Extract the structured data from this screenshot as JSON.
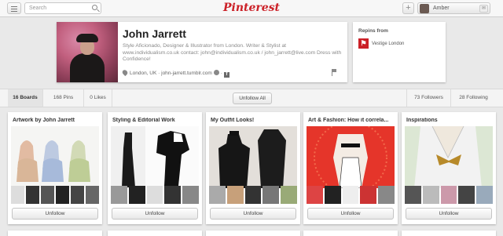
{
  "header": {
    "search_placeholder": "Search",
    "logo": "Pinterest",
    "add_label": "+",
    "user_name": "Amber"
  },
  "profile": {
    "name": "John Jarrett",
    "bio": "Style Aficionado, Designer & Illustrator from London. Writer & Stylist at www.individualism.co.uk contact: john@individualism.co.uk / john_jarrett@live.com Dress with Confidence!",
    "location": "London, UK",
    "website": "john-jarrett.tumblr.com"
  },
  "repins": {
    "title": "Repins from",
    "source": "Vestige London"
  },
  "stats": {
    "boards": "16 Boards",
    "pins": "168 Pins",
    "likes": "0 Likes",
    "unfollow_all": "Unfollow All",
    "followers": "73 Followers",
    "following": "28 Following"
  },
  "boards": [
    {
      "title": "Artwork by John Jarrett",
      "button": "Unfollow"
    },
    {
      "title": "Styling & Editorial Work",
      "button": "Unfollow"
    },
    {
      "title": "My Outfit Looks!",
      "button": "Unfollow"
    },
    {
      "title": "Art & Fashion: How it correla...",
      "button": "Unfollow"
    },
    {
      "title": "Inspirations",
      "button": "Unfollow"
    }
  ],
  "colors": {
    "brand": "#cb2027",
    "background": "#e9e9e9"
  }
}
